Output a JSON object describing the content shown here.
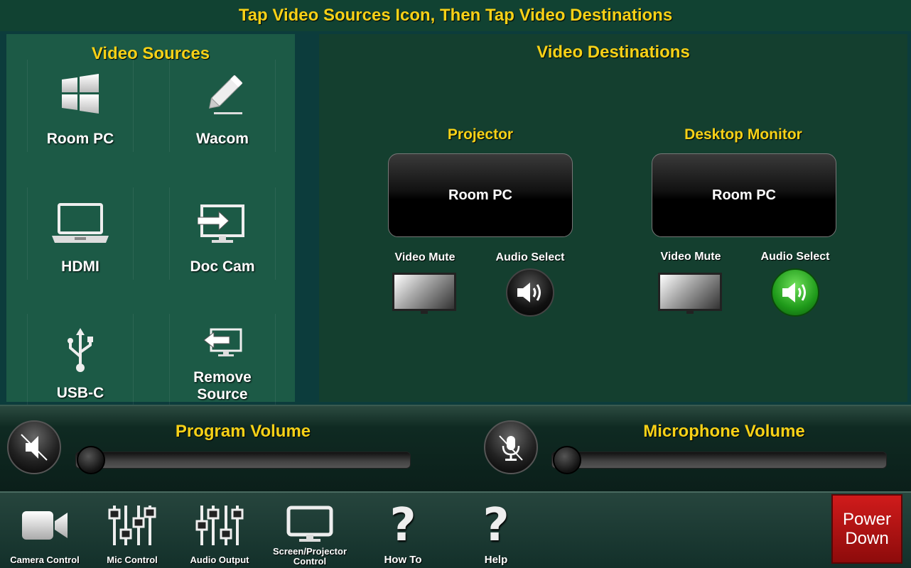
{
  "header": {
    "instruction": "Tap Video Sources Icon, Then Tap Video Destinations"
  },
  "sources": {
    "title": "Video Sources",
    "items": [
      {
        "label": "Room PC",
        "icon": "windows-icon"
      },
      {
        "label": "Wacom",
        "icon": "pen-tablet-icon"
      },
      {
        "label": "HDMI",
        "icon": "laptop-icon"
      },
      {
        "label": "Doc Cam",
        "icon": "display-input-icon"
      },
      {
        "label": "USB-C",
        "icon": "usb-icon"
      },
      {
        "label": "Remove Source",
        "label_line1": "Remove",
        "label_line2": "Source",
        "icon": "remove-source-icon"
      }
    ]
  },
  "destinations": {
    "title": "Video Destinations",
    "items": [
      {
        "name": "Projector",
        "current_source": "Room PC",
        "video_mute_label": "Video Mute",
        "audio_select_label": "Audio Select",
        "audio_selected": false
      },
      {
        "name": "Desktop Monitor",
        "current_source": "Room PC",
        "video_mute_label": "Video Mute",
        "audio_select_label": "Audio Select",
        "audio_selected": true
      }
    ]
  },
  "volume": {
    "program": {
      "title": "Program Volume",
      "level": 0
    },
    "microphone": {
      "title": "Microphone Volume",
      "level": 0
    }
  },
  "nav": {
    "items": [
      {
        "label": "Camera Control",
        "icon": "camera-icon"
      },
      {
        "label": "Mic Control",
        "icon": "mixer-icon"
      },
      {
        "label": "Audio Output",
        "icon": "mixer-icon"
      },
      {
        "label_line1": "Screen/Projector",
        "label_line2": "Control",
        "icon": "monitor-icon"
      },
      {
        "label": "How To",
        "icon": "question-icon"
      },
      {
        "label": "Help",
        "icon": "question-icon"
      }
    ],
    "power": {
      "line1": "Power",
      "line2": "Down",
      "color": "#b81212"
    }
  },
  "colors": {
    "accent": "#f7d117",
    "background": "#0f3d2e",
    "active_green": "#1f9a1a"
  }
}
